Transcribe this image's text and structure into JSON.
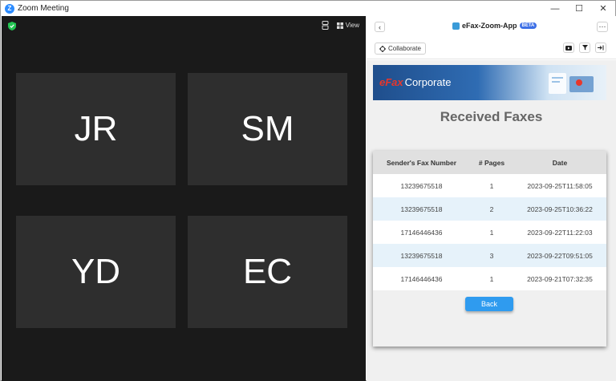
{
  "window": {
    "title": "Zoom Meeting",
    "controls": [
      "—",
      "☐",
      "✕"
    ]
  },
  "meeting": {
    "view_label": "View",
    "participants": [
      {
        "initials": "JR"
      },
      {
        "initials": "SM"
      },
      {
        "initials": "YD"
      },
      {
        "initials": "EC"
      }
    ]
  },
  "panel": {
    "app_name": "eFax-Zoom-App",
    "beta_label": "BETA",
    "collaborate_label": "Collaborate",
    "banner": {
      "brand_prefix": "eFax",
      "brand_suffix": "Corporate"
    },
    "heading": "Received Faxes",
    "table": {
      "headers": [
        "Sender's Fax Number",
        "# Pages",
        "Date"
      ],
      "rows": [
        [
          "13239675518",
          "1",
          "2023-09-25T11:58:05"
        ],
        [
          "13239675518",
          "2",
          "2023-09-25T10:36:22"
        ],
        [
          "17146446436",
          "1",
          "2023-09-22T11:22:03"
        ],
        [
          "13239675518",
          "3",
          "2023-09-22T09:51:05"
        ],
        [
          "17146446436",
          "1",
          "2023-09-21T07:32:35"
        ]
      ]
    },
    "back_label": "Back"
  },
  "colors": {
    "accent": "#2f9bef",
    "beta_badge": "#3d6fe6",
    "row_alt": "#e6f2fa",
    "tile": "#2e2e2e",
    "meeting_bg": "#1a1a1a"
  }
}
